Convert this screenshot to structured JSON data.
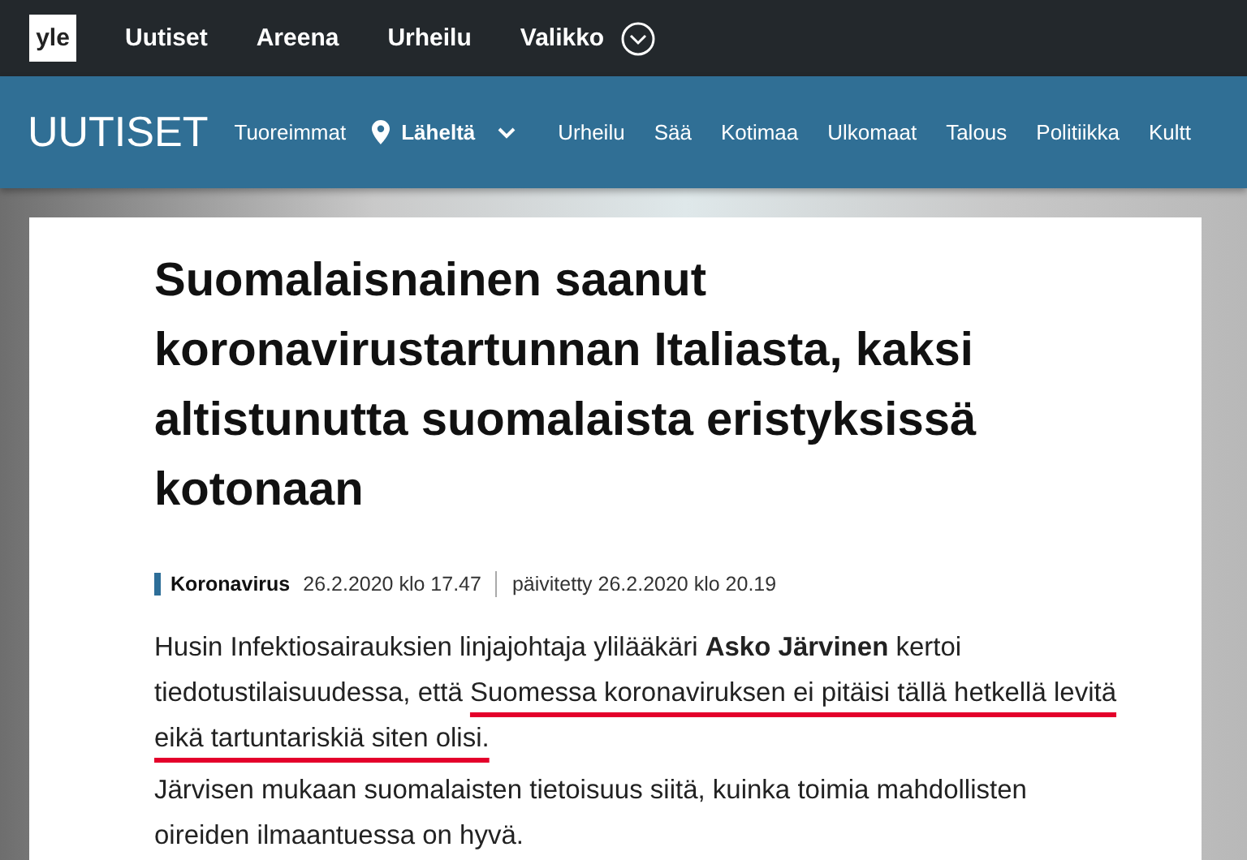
{
  "top_nav": {
    "logo": "yle",
    "items": [
      "Uutiset",
      "Areena",
      "Urheilu"
    ],
    "menu": {
      "label": "Valikko"
    }
  },
  "section_nav": {
    "title": "UUTISET",
    "items": [
      {
        "label": "Tuoreimmat",
        "kind": "link"
      },
      {
        "label": "Läheltä",
        "kind": "location"
      },
      {
        "label": "Urheilu",
        "kind": "link"
      },
      {
        "label": "Sää",
        "kind": "link"
      },
      {
        "label": "Kotimaa",
        "kind": "link"
      },
      {
        "label": "Ulkomaat",
        "kind": "link"
      },
      {
        "label": "Talous",
        "kind": "link"
      },
      {
        "label": "Politiikka",
        "kind": "link"
      },
      {
        "label": "Kultt",
        "kind": "link"
      }
    ]
  },
  "article": {
    "headline": "Suomalaisnainen saanut koronavirustartunnan Italiasta, kaksi altistunutta suomalaista eristyksissä kotonaan",
    "category": "Koronavirus",
    "published": "26.2.2020 klo 17.47",
    "updated": "päivitetty 26.2.2020 klo 20.19",
    "paragraphs": [
      {
        "text": "Husin Infektiosairauksien linjajohtaja ylilääkäri **Asko Järvinen** kertoi tiedotustilaisuudessa, että ",
        "underlined_text": "Suomessa koronaviruksen ei pitäisi tällä hetkellä levitä eikä tartuntariskiä siten olisi."
      },
      {
        "text": "Järvisen mukaan suomalaisten tietoisuus siitä, kuinka toimia mahdollisten oireiden ilmaantuessa on hyvä."
      }
    ]
  }
}
